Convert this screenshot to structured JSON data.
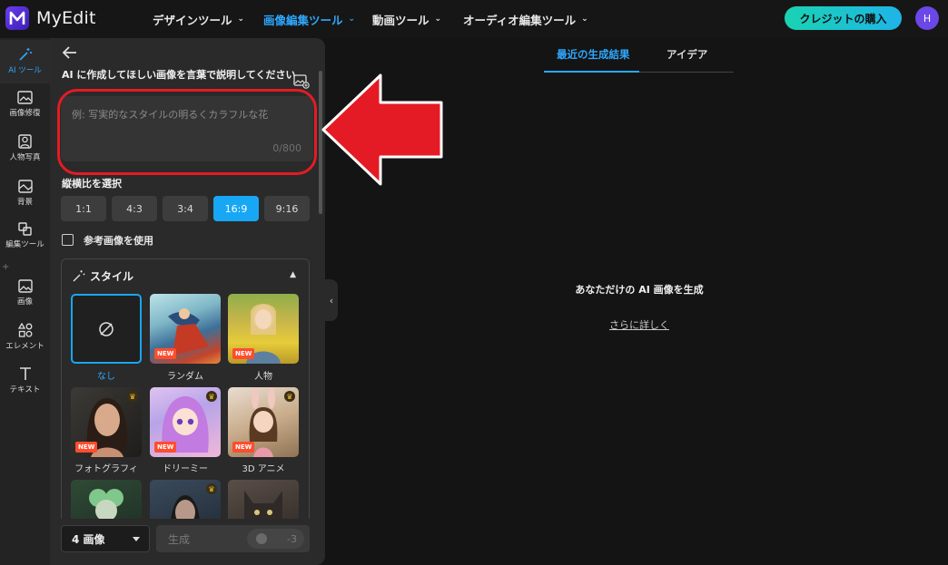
{
  "app": {
    "name": "MyEdit",
    "logo_icon": "myedit-logo-icon"
  },
  "topnav": [
    {
      "label": "デザインツール",
      "active": false
    },
    {
      "label": "画像編集ツール",
      "active": true
    },
    {
      "label": "動画ツール",
      "active": false
    },
    {
      "label": "オーディオ編集ツール",
      "active": false
    }
  ],
  "header": {
    "buy_label": "クレジットの購入",
    "avatar_initial": "H"
  },
  "rail": [
    {
      "label": "AI ツール",
      "icon": "magic-wand-icon",
      "active": true
    },
    {
      "label": "画像修復",
      "icon": "image-repair-icon"
    },
    {
      "label": "人物写真",
      "icon": "portrait-icon"
    },
    {
      "label": "背景",
      "icon": "background-icon"
    },
    {
      "label": "編集ツール",
      "icon": "edit-tools-icon"
    },
    {
      "label": "画像",
      "icon": "image-icon"
    },
    {
      "label": "エレメント",
      "icon": "elements-icon"
    },
    {
      "label": "テキスト",
      "icon": "text-icon"
    }
  ],
  "panel": {
    "prompt_label": "AI に作成してほしい画像を言葉で説明してください",
    "prompt_placeholder": "例: 写実的なスタイルの明るくカラフルな花",
    "prompt_counter": "0/800",
    "ratio_label": "縦横比を選択",
    "ratios": [
      "1:1",
      "4:3",
      "3:4",
      "16:9",
      "9:16"
    ],
    "ratio_selected": "16:9",
    "reference_label": "参考画像を使用",
    "style_title": "スタイル",
    "styles": [
      {
        "label": "なし",
        "selected": true
      },
      {
        "label": "ランダム",
        "new": true
      },
      {
        "label": "人物",
        "new": true
      },
      {
        "label": "フォトグラフィ",
        "new": true,
        "premium": true
      },
      {
        "label": "ドリーミー",
        "new": true,
        "premium": true
      },
      {
        "label": "3D アニメ",
        "new": true,
        "premium": true
      }
    ],
    "new_badge": "NEW",
    "count_select": "4 画像",
    "generate_label": "生成",
    "credit_cost": "-3"
  },
  "main": {
    "tabs": [
      "最近の生成結果",
      "アイデア"
    ],
    "empty_title": "あなただけの AI 画像を生成",
    "learn_more": "さらに詳しく"
  },
  "colors": {
    "accent": "#17a7f5",
    "annotation": "#e41b24",
    "buy_gradient": [
      "#19d3b3",
      "#1fb4e8"
    ]
  }
}
